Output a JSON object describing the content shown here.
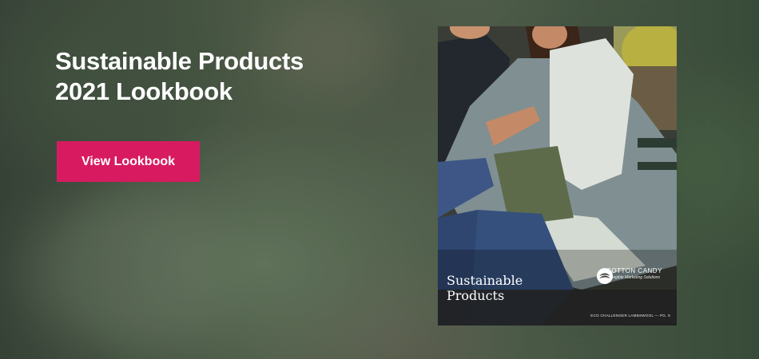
{
  "banner": {
    "headline_line1": "Sustainable Products",
    "headline_line2": "2021 Lookbook",
    "cta_label": "View Lookbook",
    "cta_color": "#d81b60",
    "background_description_colors": [
      "#3d4a3d",
      "#56664f",
      "#5b6b55"
    ]
  },
  "cover": {
    "title_line1": "Sustainable",
    "title_line2": "Products",
    "brand_name": "COTTON CANDY",
    "brand_tagline": "Tangible Marketing Solutions",
    "caption": "ECO CHALLENGER LAMBSWOOL — PG. 9"
  }
}
